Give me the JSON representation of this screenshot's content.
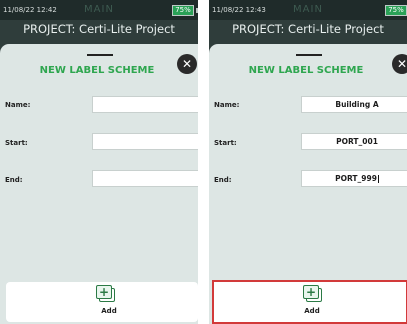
{
  "left_screen": {
    "status": {
      "time": "11/08/22 12:42",
      "mode": "MAIN",
      "battery": "75%"
    },
    "project_title": "PROJECT: Certi-Lite Project",
    "sheet": {
      "title": "NEW LABEL SCHEME",
      "close_icon": "close-circle-icon",
      "fields": {
        "name_label": "Name:",
        "name_value": "",
        "start_label": "Start:",
        "start_value": "",
        "end_label": "End:",
        "end_value": ""
      },
      "add_label": "Add"
    }
  },
  "right_screen": {
    "status": {
      "time": "11/08/22 12:43",
      "mode": "MAIN",
      "battery": "75%"
    },
    "project_title": "PROJECT: Certi-Lite Project",
    "sheet": {
      "title": "NEW LABEL SCHEME",
      "close_icon": "close-circle-icon",
      "fields": {
        "name_label": "Name:",
        "name_value": "Building A",
        "start_label": "Start:",
        "start_value": "PORT_001",
        "end_label": "End:",
        "end_value": "PORT_999"
      },
      "add_label": "Add"
    }
  },
  "colors": {
    "accent_green": "#2ea64f",
    "battery_green": "#2aa157",
    "highlight_red": "#d23a3a",
    "header_bg": "#2f3d3b",
    "sheet_bg": "#dde6e4"
  }
}
